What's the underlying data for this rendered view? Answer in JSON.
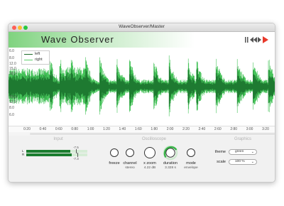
{
  "window": {
    "title": "WaveObserver/Master",
    "app_title": "Wave Observer",
    "accent": "#3ab54a",
    "play_color": "#e8392b"
  },
  "waveform": {
    "legend": [
      "left",
      "right"
    ],
    "y_labels_top": [
      "6.0",
      "8.0",
      "12.0",
      "15.0",
      "18.0"
    ],
    "y_labels_bottom": [
      "15.0",
      "12.0",
      "8.0",
      "6.0"
    ],
    "time_ticks": [
      "0:20",
      "0:40",
      "0:60",
      "0:80",
      "1:00",
      "1:20",
      "1:40",
      "1:60",
      "1:80",
      "2:00",
      "2:20",
      "2:40",
      "2:60",
      "2:80",
      "3:00",
      "3:20"
    ]
  },
  "sections": {
    "input": {
      "title": "Input",
      "meter_top_value": "-7.5",
      "meter_bottom_value": "-7.3",
      "channel_l": "L",
      "channel_r": "R",
      "level_left": 0.72,
      "level_right": 0.74
    },
    "oscilloscope": {
      "title": "Oscilloscope",
      "controls": [
        {
          "label": "freeze",
          "value": ""
        },
        {
          "label": "channel",
          "value": "stereo"
        },
        {
          "label": "x zoom",
          "value": "4.22 dB"
        },
        {
          "label": "duration",
          "value": "3.328 s"
        },
        {
          "label": "mode",
          "value": "envelope"
        }
      ]
    },
    "graphics": {
      "title": "Graphics",
      "theme_label": "theme",
      "theme_value": "green",
      "scale_label": "scale",
      "scale_value": "100 %"
    }
  }
}
